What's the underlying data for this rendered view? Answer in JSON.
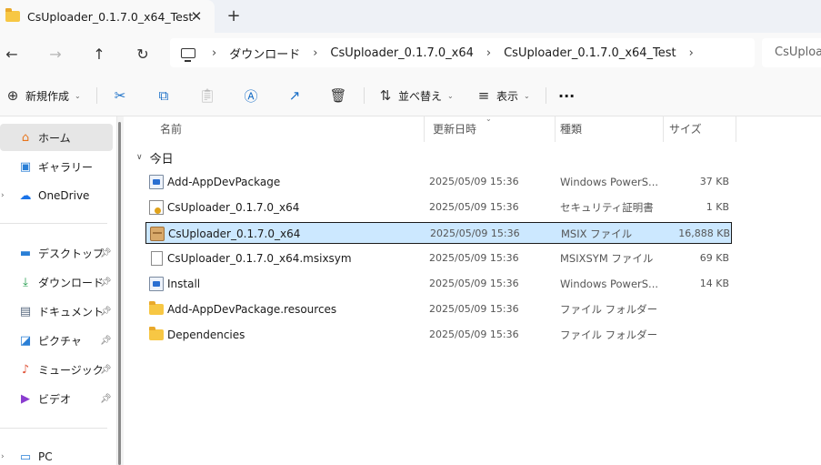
{
  "tab": {
    "title": "CsUploader_0.1.7.0_x64_Test",
    "close_label": "✕",
    "new_tab_label": "+"
  },
  "nav": {
    "back_label": "←",
    "forward_label": "→",
    "up_label": "↑",
    "refresh_label": "↻",
    "breadcrumb": [
      "ダウンロード",
      "CsUploader_0.1.7.0_x64",
      "CsUploader_0.1.7.0_x64_Test"
    ],
    "search_placeholder": "CsUploa"
  },
  "toolbar": {
    "new_label": "新規作成",
    "sort_label": "並べ替え",
    "view_label": "表示",
    "more_label": "···"
  },
  "sidebar": {
    "home": "ホーム",
    "gallery": "ギャラリー",
    "onedrive": "OneDrive",
    "pinned": [
      "デスクトップ",
      "ダウンロード",
      "ドキュメント",
      "ピクチャ",
      "ミュージック",
      "ビデオ"
    ],
    "pc": "PC"
  },
  "columns": {
    "name": "名前",
    "date": "更新日時",
    "type": "種類",
    "size": "サイズ"
  },
  "group_label": "今日",
  "files": [
    {
      "name": "Add-AppDevPackage",
      "date": "2025/05/09 15:36",
      "type": "Windows PowerS...",
      "size": "37 KB",
      "icon": "powershell-script"
    },
    {
      "name": "CsUploader_0.1.7.0_x64",
      "date": "2025/05/09 15:36",
      "type": "セキュリティ証明書",
      "size": "1 KB",
      "icon": "certificate"
    },
    {
      "name": "CsUploader_0.1.7.0_x64",
      "date": "2025/05/09 15:36",
      "type": "MSIX ファイル",
      "size": "16,888 KB",
      "icon": "msix-package",
      "selected": true
    },
    {
      "name": "CsUploader_0.1.7.0_x64.msixsym",
      "date": "2025/05/09 15:36",
      "type": "MSIXSYM ファイル",
      "size": "69 KB",
      "icon": "document"
    },
    {
      "name": "Install",
      "date": "2025/05/09 15:36",
      "type": "Windows PowerS...",
      "size": "14 KB",
      "icon": "powershell-script"
    },
    {
      "name": "Add-AppDevPackage.resources",
      "date": "2025/05/09 15:36",
      "type": "ファイル フォルダー",
      "size": "",
      "icon": "folder"
    },
    {
      "name": "Dependencies",
      "date": "2025/05/09 15:36",
      "type": "ファイル フォルダー",
      "size": "",
      "icon": "folder"
    }
  ]
}
